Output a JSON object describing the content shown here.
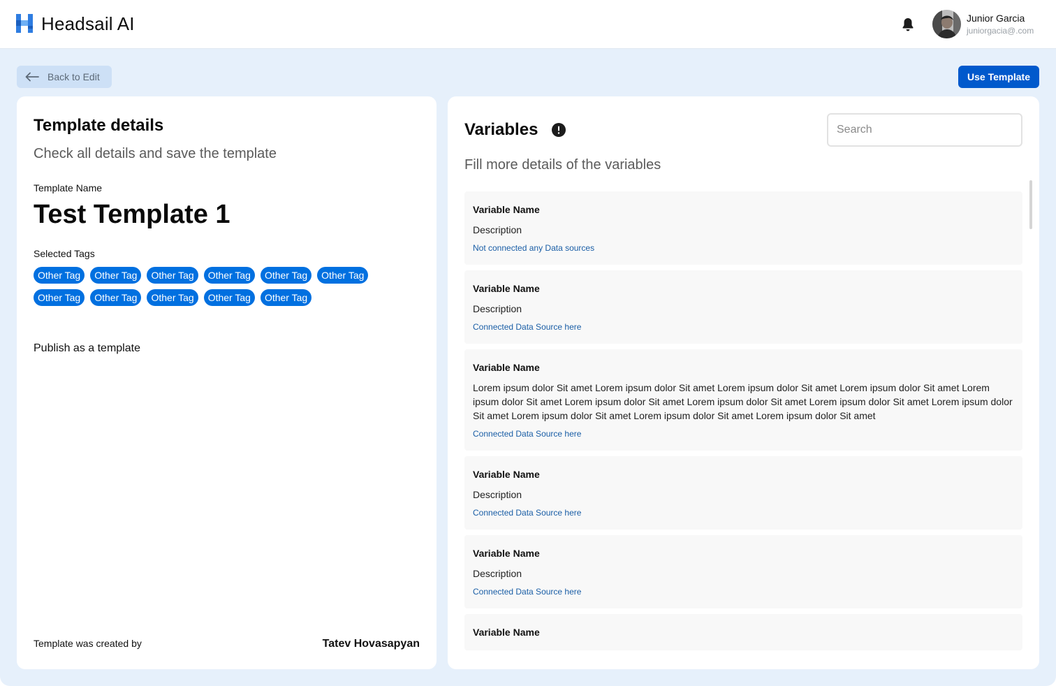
{
  "header": {
    "brand": "Headsail AI",
    "user_name": "Junior Garcia",
    "user_email": "juniorgacia@.com"
  },
  "toolbar": {
    "back_label": "Back to Edit",
    "use_label": "Use Template"
  },
  "details": {
    "title": "Template details",
    "subtitle": "Check all details and save the template",
    "name_label": "Template Name",
    "name_value": "Test Template 1",
    "tags_label": "Selected Tags",
    "tags_row1": [
      "Other Tag",
      "Other Tag",
      "Other Tag",
      "Other Tag",
      "Other Tag",
      "Other Tag"
    ],
    "tags_row2": [
      "Other Tag",
      "Other Tag",
      "Other Tag",
      "Other Tag",
      "Other Tag"
    ],
    "publish_label": "Publish as a template",
    "created_by_label": "Template was created by",
    "created_by_name": "Tatev Hovasapyan"
  },
  "variables": {
    "title": "Variables",
    "subtitle": "Fill more details of the variables",
    "search_placeholder": "Search",
    "items": [
      {
        "name": "Variable Name",
        "description": "Description",
        "source": "Not connected any Data sources"
      },
      {
        "name": "Variable Name",
        "description": "Description",
        "source": "Connected Data Source here"
      },
      {
        "name": "Variable Name",
        "description": "Lorem ipsum dolor Sit amet Lorem ipsum dolor Sit amet Lorem ipsum dolor Sit amet Lorem ipsum dolor Sit amet Lorem ipsum dolor Sit amet Lorem ipsum dolor Sit amet Lorem ipsum dolor Sit amet Lorem ipsum dolor Sit amet Lorem ipsum dolor Sit amet Lorem ipsum dolor Sit amet Lorem ipsum dolor Sit amet Lorem ipsum dolor Sit amet",
        "source": "Connected Data Source here"
      },
      {
        "name": "Variable Name",
        "description": "Description",
        "source": "Connected Data Source here"
      },
      {
        "name": "Variable Name",
        "description": "Description",
        "source": "Connected Data Source here"
      },
      {
        "name": "Variable Name",
        "description": "",
        "source": ""
      }
    ]
  },
  "colors": {
    "primary": "#0059cc",
    "tag": "#0070e0",
    "page_bg": "#e6f0fb",
    "link": "#1a5ea6"
  },
  "icons": [
    "headsail-logo-icon",
    "bell-icon",
    "arrow-left-icon",
    "info-icon"
  ]
}
